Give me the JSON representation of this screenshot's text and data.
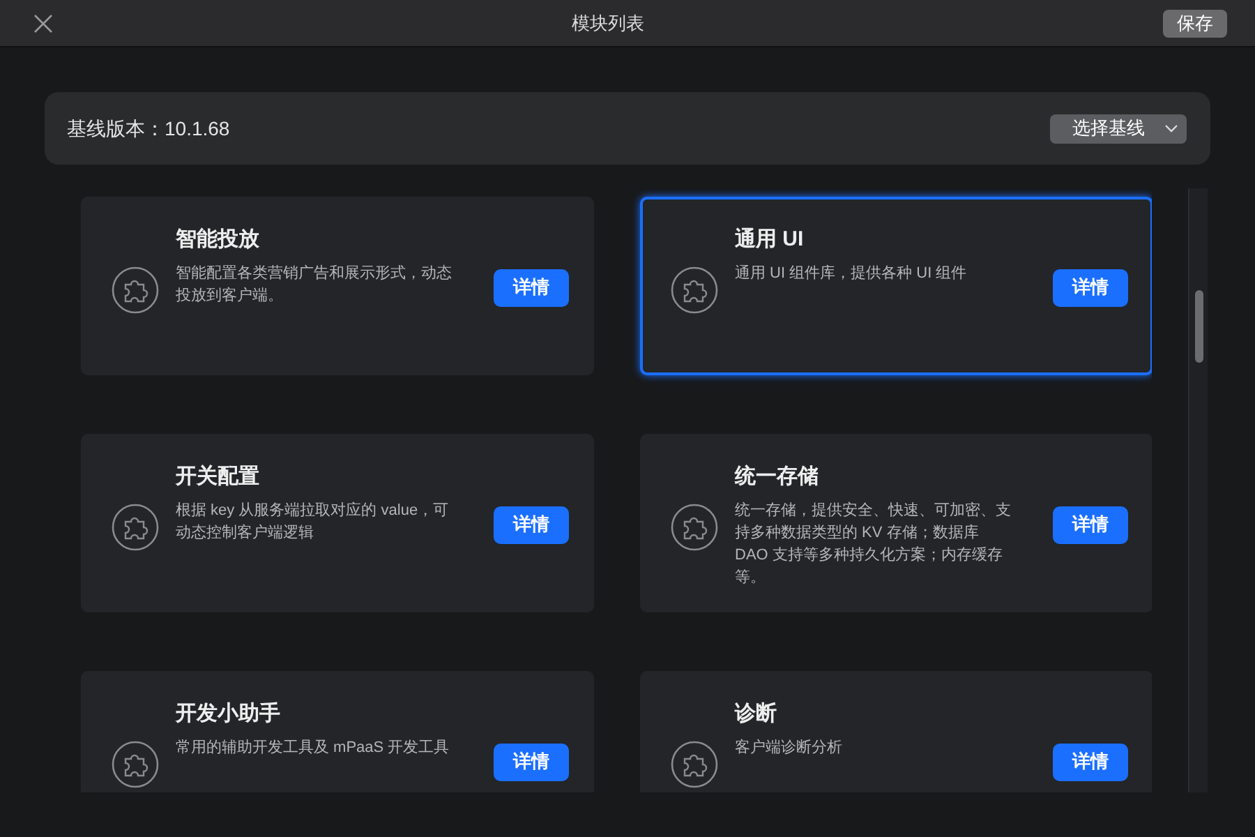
{
  "window": {
    "title": "模块列表",
    "save_button": "保存"
  },
  "baseline": {
    "label": "基线版本：10.1.68",
    "select_button": "选择基线"
  },
  "modules": [
    {
      "title": "智能投放",
      "description": "智能配置各类营销广告和展示形式，动态投放到客户端。",
      "button": "详情",
      "selected": false
    },
    {
      "title": "通用 UI",
      "description": "通用 UI 组件库，提供各种 UI 组件",
      "button": "详情",
      "selected": true
    },
    {
      "title": "开关配置",
      "description": "根据 key 从服务端拉取对应的 value，可动态控制客户端逻辑",
      "button": "详情",
      "selected": false
    },
    {
      "title": "统一存储",
      "description": "统一存储，提供安全、快速、可加密、支持多种数据类型的 KV 存储；数据库 DAO 支持等多种持久化方案；内存缓存等。",
      "button": "详情",
      "selected": false
    },
    {
      "title": "开发小助手",
      "description": "常用的辅助开发工具及 mPaaS 开发工具",
      "button": "详情",
      "selected": false
    },
    {
      "title": "诊断",
      "description": "客户端诊断分析",
      "button": "详情",
      "selected": false
    }
  ]
}
